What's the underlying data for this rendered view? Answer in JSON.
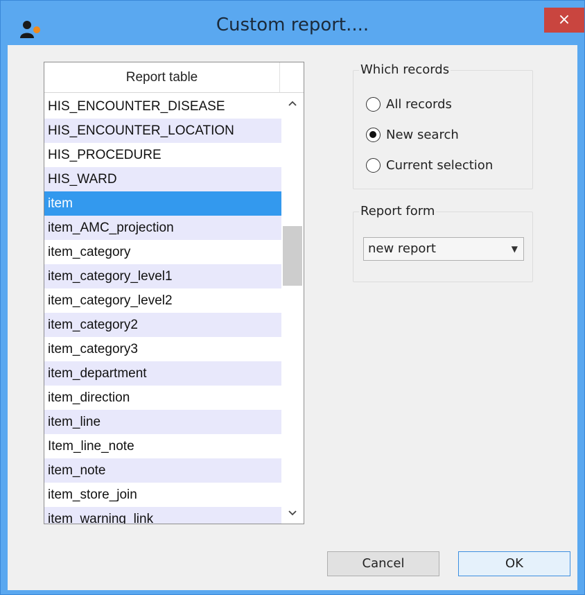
{
  "window": {
    "title": "Custom report....",
    "close_label": "×"
  },
  "report_table": {
    "header": "Report table",
    "selected_index": 4,
    "items": [
      "HIS_ENCOUNTER_DISEASE",
      "HIS_ENCOUNTER_LOCATION",
      "HIS_PROCEDURE",
      "HIS_WARD",
      "item",
      "item_AMC_projection",
      "item_category",
      "item_category_level1",
      "item_category_level2",
      "item_category2",
      "item_category3",
      "item_department",
      "item_direction",
      "item_line",
      "Item_line_note",
      "item_note",
      "item_store_join",
      "item_warning_link"
    ]
  },
  "which_records": {
    "legend": "Which records",
    "options": [
      {
        "label": "All records",
        "checked": false
      },
      {
        "label": "New search",
        "checked": true
      },
      {
        "label": "Current selection",
        "checked": false
      }
    ]
  },
  "report_form": {
    "legend": "Report form",
    "selected_value": "new report"
  },
  "buttons": {
    "cancel": "Cancel",
    "ok": "OK"
  },
  "icons": {
    "app": "app-person-icon",
    "scroll_up": "chevron-up-icon",
    "scroll_down": "chevron-down-icon",
    "dropdown": "caret-down-icon"
  },
  "colors": {
    "titlebar": "#5aa8f0",
    "selection": "#3399ee",
    "alt_row": "#e8e8fb",
    "close_button": "#c9453f"
  }
}
